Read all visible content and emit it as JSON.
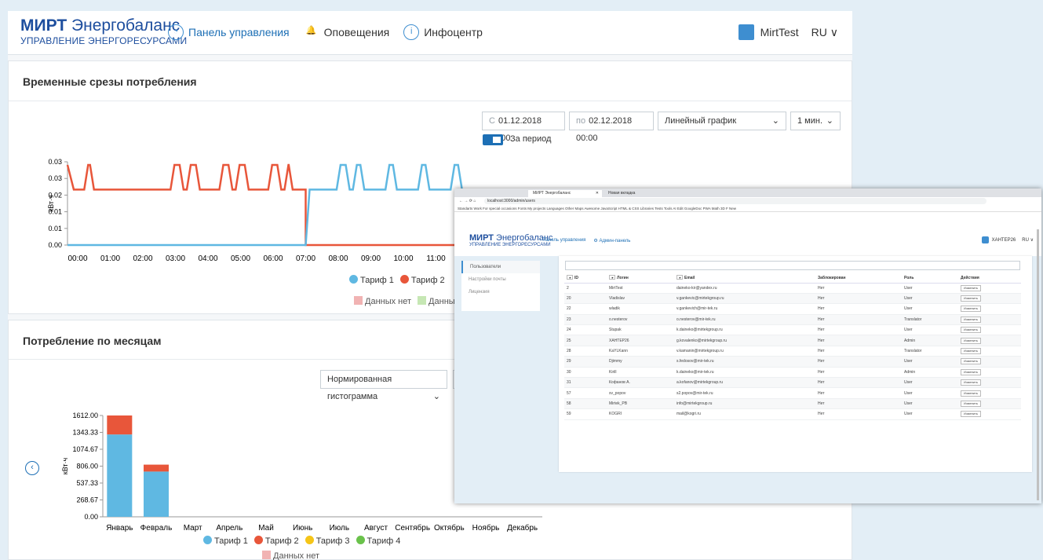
{
  "app": {
    "logo_brand": "МИРТ",
    "logo_name": "Энергобаланс",
    "logo_sub": "УПРАВЛЕНИЕ ЭНЕРГОРЕСУРСАМИ",
    "nav": [
      {
        "label": "Панель управления",
        "icon": "dashboard-icon"
      },
      {
        "label": "Оповещения",
        "icon": "bell-icon"
      },
      {
        "label": "Инфоцентр",
        "icon": "info-icon"
      }
    ],
    "user": "MirtTest",
    "lang": "RU ∨"
  },
  "slices": {
    "title": "Временные срезы потребления",
    "from_prefix": "С",
    "from": "01.12.2018 00:00",
    "to_prefix": "по",
    "to": "02.12.2018 00:00",
    "chart_type": "Линейный график",
    "interval": "1 мин.",
    "period_label": "За период",
    "unit": "кВт·ч",
    "yticks": [
      "0.03",
      "0.03",
      "0.02",
      "0.01",
      "0.01",
      "0.00"
    ],
    "xticks": [
      "00:00",
      "01:00",
      "02:00",
      "03:00",
      "04:00",
      "05:00",
      "06:00",
      "07:00",
      "08:00",
      "09:00",
      "10:00",
      "11:00",
      "1"
    ],
    "legend": [
      "Тариф 1",
      "Тариф 2"
    ],
    "legend2": [
      "Данных нет",
      "Данные"
    ]
  },
  "monthly": {
    "title": "Потребление по месяцам",
    "chart_type": "Нормированная гистограмма",
    "unit": "кВт·ч",
    "legend": [
      "Тариф 1",
      "Тариф 2",
      "Тариф 3",
      "Тариф 4"
    ],
    "legend2": "Данных нет"
  },
  "chart_data": [
    {
      "type": "line",
      "title": "",
      "ylabel": "кВт·ч",
      "ylim": [
        0,
        0.03
      ],
      "x": [
        "00:00",
        "01:00",
        "02:00",
        "03:00",
        "04:00",
        "05:00",
        "06:00",
        "07:00",
        "08:00",
        "09:00",
        "10:00",
        "11:00"
      ],
      "series": [
        {
          "name": "Тариф 1",
          "color": "#5fb8e2",
          "values": [
            0,
            0,
            0,
            0,
            0,
            0,
            0,
            0.02,
            0.02,
            0.02,
            0.02,
            0.02
          ]
        },
        {
          "name": "Тариф 2",
          "color": "#e8563a",
          "values": [
            0.02,
            0.02,
            0.02,
            0.02,
            0.02,
            0.02,
            0.02,
            0,
            0,
            0,
            0,
            0
          ]
        }
      ]
    },
    {
      "type": "bar",
      "title": "",
      "ylabel": "кВт·ч",
      "ylim": [
        0,
        1612
      ],
      "yticks": [
        "1612.00",
        "1343.33",
        "1074.67",
        "806.00",
        "537.33",
        "268.67",
        "0.00"
      ],
      "categories": [
        "Январь",
        "Февраль",
        "Март",
        "Апрель",
        "Май",
        "Июнь",
        "Июль",
        "Август",
        "Сентябрь",
        "Октябрь",
        "Ноябрь",
        "Декабрь"
      ],
      "series": [
        {
          "name": "Тариф 1",
          "color": "#5fb8e2",
          "values": [
            1310,
            720,
            0,
            0,
            0,
            0,
            0,
            0,
            0,
            0,
            0,
            0
          ]
        },
        {
          "name": "Тариф 2",
          "color": "#e8563a",
          "values": [
            302,
            110,
            0,
            0,
            0,
            0,
            0,
            0,
            0,
            0,
            0,
            0
          ]
        },
        {
          "name": "Тариф 3",
          "color": "#f5c518",
          "values": [
            0,
            0,
            0,
            0,
            0,
            0,
            0,
            0,
            0,
            0,
            0,
            0
          ]
        },
        {
          "name": "Тариф 4",
          "color": "#6ac24b",
          "values": [
            0,
            0,
            0,
            0,
            0,
            0,
            0,
            0,
            0,
            0,
            0,
            0
          ]
        }
      ]
    }
  ],
  "popup": {
    "tab1": "МИРТ Энергобаланс",
    "tab2": "Новая вкладка",
    "url": "localhost:3000/admin/users",
    "bookmarks": "Standarts  Work  For special occasions  Fonts  My projects  Languages  Other  Maps  Awesome  JavaScript  HTML & CSS  Libraries  Tests  Tools  AI  Edit  GoogleDoc  PWA  Math  3D  F  New",
    "nav1": "Панель управления",
    "nav2": "Админ-панель",
    "user": "ХАНТЕР26",
    "lang": "RU ∨",
    "side": [
      "Пользователи",
      "Настройки почты",
      "Лицензия"
    ],
    "headers": [
      "ID",
      "Логин",
      "Email",
      "Заблокирован",
      "Роль",
      "Действия"
    ],
    "edit": "Изменить",
    "rows": [
      [
        "2",
        "MirtTest",
        "daineko-kir@yandex.ru",
        "Нет",
        "User"
      ],
      [
        "20",
        "Vladislav",
        "v.gankevic@mirtekgroup.ru",
        "Нет",
        "User"
      ],
      [
        "22",
        "wladik",
        "v.gankevich@mir-tek.ru",
        "Нет",
        "User"
      ],
      [
        "23",
        "o.nesterov",
        "o.nesterov@mir-tek.ru",
        "Нет",
        "Translator"
      ],
      [
        "24",
        "Stupak",
        "k.daineko@mirtekgroup.ru",
        "Нет",
        "User"
      ],
      [
        "25",
        "ХАНТЕР26",
        "g.kovalenko@mirtekgroup.ru",
        "Нет",
        "Admin"
      ],
      [
        "28",
        "KaYLKann",
        "v.kamanin@mirtekgroup.ru",
        "Нет",
        "Translator"
      ],
      [
        "29",
        "Djimmy",
        "s.fedosov@mir-tek.ru",
        "Нет",
        "User"
      ],
      [
        "30",
        "Kirill",
        "k.daineko@mir-tek.ru",
        "Нет",
        "Admin"
      ],
      [
        "31",
        "Кофанов А.",
        "a.kofanov@mirtekgroup.ru",
        "Нет",
        "User"
      ],
      [
        "57",
        "sv_popov",
        "s2.popov@mir-tek.ru",
        "Нет",
        "User"
      ],
      [
        "58",
        "Mirtek_PB",
        "info@mirtekgroup.ru",
        "Нет",
        "User"
      ],
      [
        "59",
        "KOGRI",
        "mail@kogri.ru",
        "Нет",
        "User"
      ]
    ]
  }
}
